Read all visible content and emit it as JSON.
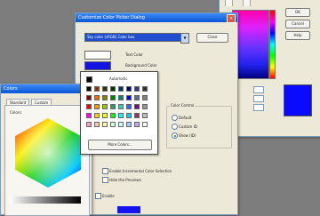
{
  "dialog": {
    "title": "Customize Color Picker Dialog",
    "dropdown_value": "Sky color (sRGB) Color box",
    "button_label": "Close",
    "text_color_label": "Text Color",
    "background_color_label": "Background Color"
  },
  "dropdown_panel": {
    "automatic_label": "Automatic",
    "more_colors_label": "More Colors..."
  },
  "group_label": "Color Control",
  "options": {
    "radios": [
      "Default",
      "Custom ID",
      "Show (ID)"
    ],
    "checkboxes": [
      "Enable Incremental Color Selection",
      "Hide the Previews",
      "Enable"
    ]
  },
  "back_window": {
    "buttons": [
      "OK",
      "Cancel",
      "Help"
    ],
    "preview_color": "#0a0aff"
  },
  "left_window": {
    "title": "Colors",
    "tabs": [
      "Standard",
      "Custom"
    ],
    "colors_label": "Colors:"
  },
  "swatch_colors": [
    "#000000",
    "#993300",
    "#333300",
    "#003300",
    "#003366",
    "#000080",
    "#333399",
    "#333333",
    "#800000",
    "#ff6600",
    "#808000",
    "#008000",
    "#008080",
    "#0000ff",
    "#666699",
    "#808080",
    "#ff0000",
    "#ff9900",
    "#99cc00",
    "#339966",
    "#33cccc",
    "#3366ff",
    "#800080",
    "#969696",
    "#ff00ff",
    "#ffcc00",
    "#ffff00",
    "#00ff00",
    "#00ffff",
    "#00ccff",
    "#993366",
    "#c0c0c0",
    "#ff99cc",
    "#ffcc99",
    "#ffff99",
    "#ccffcc",
    "#ccffff",
    "#99ccff",
    "#cc99ff",
    "#ffffff"
  ]
}
